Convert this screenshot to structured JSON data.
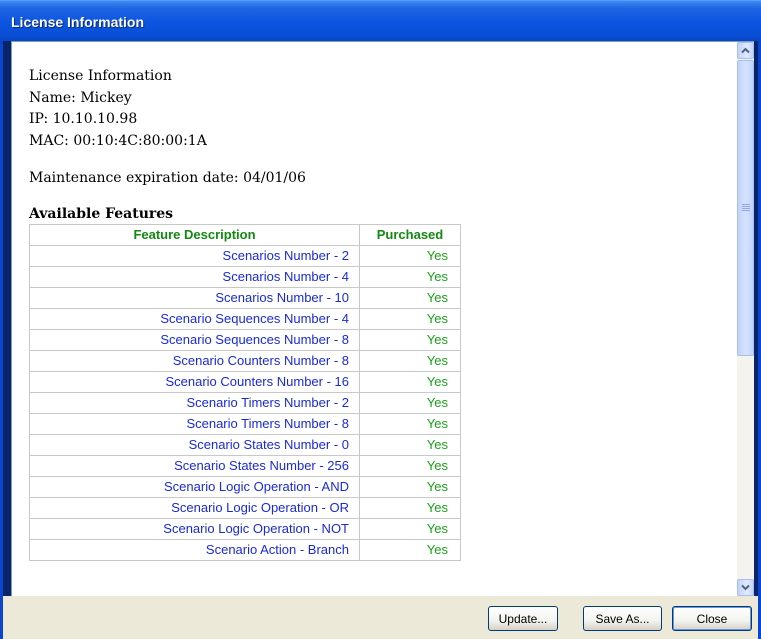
{
  "window": {
    "title": "License Information"
  },
  "license": {
    "heading": "License Information",
    "name_line": "Name: Mickey",
    "ip_line": "IP: 10.10.10.98",
    "mac_line": "MAC: 00:10:4C:80:00:1A",
    "maintenance_line": "Maintenance expiration date: 04/01/06"
  },
  "features": {
    "heading": "Available Features",
    "columns": [
      "Feature Description",
      "Purchased"
    ],
    "rows": [
      {
        "description": "Scenarios Number - 2",
        "purchased": "Yes"
      },
      {
        "description": "Scenarios Number - 4",
        "purchased": "Yes"
      },
      {
        "description": "Scenarios Number - 10",
        "purchased": "Yes"
      },
      {
        "description": "Scenario Sequences Number - 4",
        "purchased": "Yes"
      },
      {
        "description": "Scenario Sequences Number - 8",
        "purchased": "Yes"
      },
      {
        "description": "Scenario Counters Number - 8",
        "purchased": "Yes"
      },
      {
        "description": "Scenario Counters Number - 16",
        "purchased": "Yes"
      },
      {
        "description": "Scenario Timers Number - 2",
        "purchased": "Yes"
      },
      {
        "description": "Scenario Timers Number - 8",
        "purchased": "Yes"
      },
      {
        "description": "Scenario States Number - 0",
        "purchased": "Yes"
      },
      {
        "description": "Scenario States Number - 256",
        "purchased": "Yes"
      },
      {
        "description": "Scenario Logic Operation - AND",
        "purchased": "Yes"
      },
      {
        "description": "Scenario Logic Operation - OR",
        "purchased": "Yes"
      },
      {
        "description": "Scenario Logic Operation - NOT",
        "purchased": "Yes"
      },
      {
        "description": "Scenario Action - Branch",
        "purchased": "Yes"
      }
    ]
  },
  "buttons": {
    "update": "Update...",
    "save_as": "Save As...",
    "close": "Close"
  },
  "icons": {
    "scroll_up": "chevron-up-icon",
    "scroll_down": "chevron-down-icon"
  },
  "colors": {
    "title_bar": "#0b55e0",
    "header_text": "#128a12",
    "description_text": "#1a2ad8",
    "purchased_text": "#1aa21a"
  }
}
